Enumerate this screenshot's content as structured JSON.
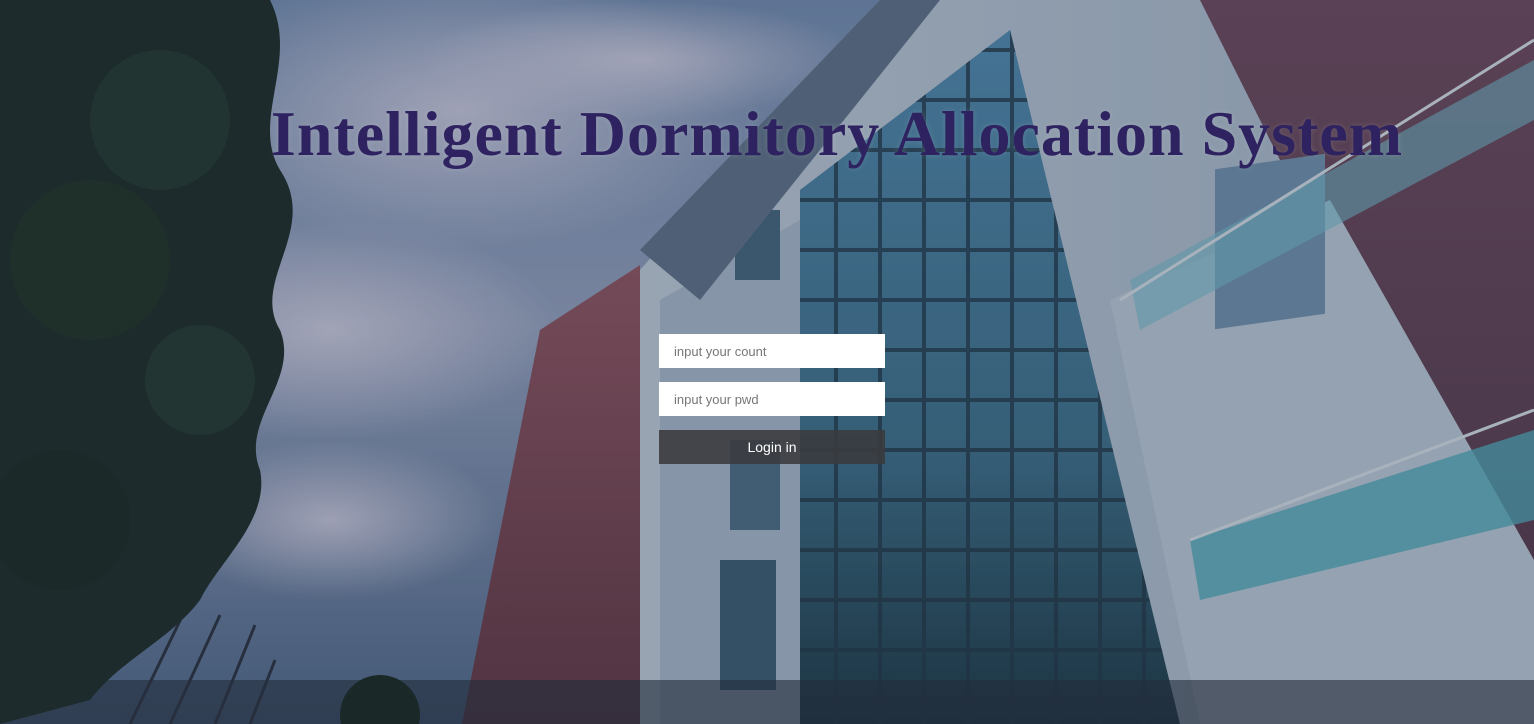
{
  "page": {
    "title": "Intelligent Dormitory Allocation System"
  },
  "login": {
    "account_placeholder": "input your count",
    "password_placeholder": "input your pwd",
    "submit_label": "Login in"
  },
  "colors": {
    "title": "#2e2360",
    "button_bg": "#3a3a3e",
    "input_bg": "#ffffff"
  }
}
